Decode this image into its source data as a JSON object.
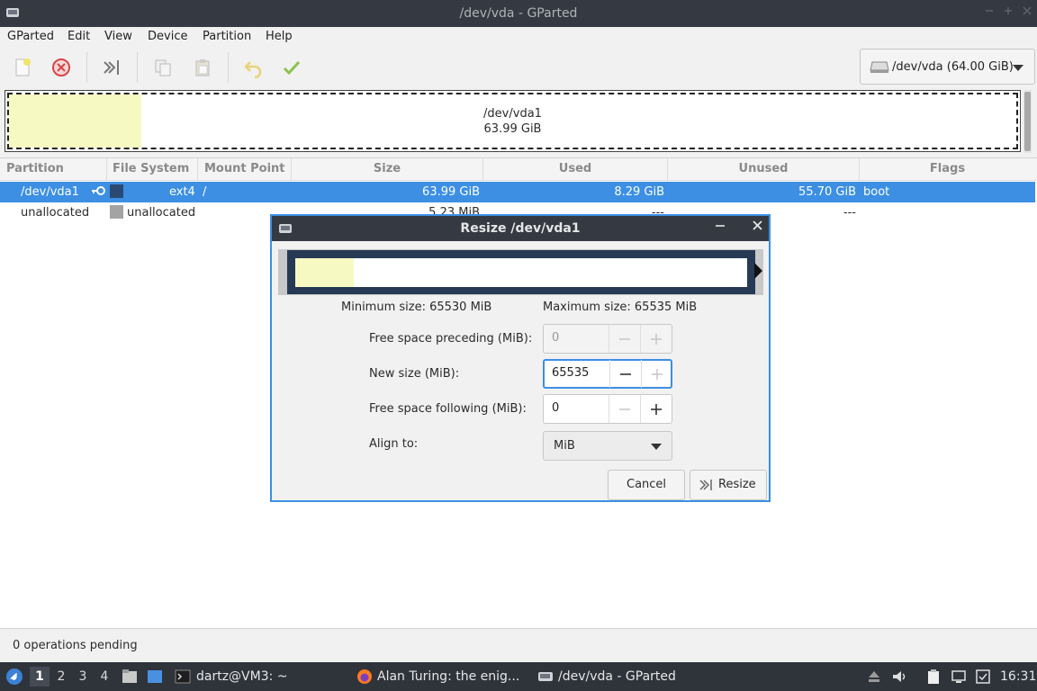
{
  "window": {
    "title": "/dev/vda - GParted"
  },
  "menubar": {
    "items": [
      "GParted",
      "Edit",
      "View",
      "Device",
      "Partition",
      "Help"
    ]
  },
  "toolbar": {
    "buttons": [
      "new-icon",
      "delete-icon",
      "resize-move-icon",
      "copy-icon",
      "paste-icon",
      "undo-icon",
      "apply-icon"
    ],
    "device_label": "/dev/vda (64.00 GiB)"
  },
  "disk_map": {
    "partition_name": "/dev/vda1",
    "partition_size": "63.99 GiB",
    "used_fraction": 0.13,
    "colors": {
      "used": "#f7f9c2",
      "frame": "#263a55"
    }
  },
  "table": {
    "columns": [
      "Partition",
      "File System",
      "Mount Point",
      "Size",
      "Used",
      "Unused",
      "Flags"
    ],
    "rows": [
      {
        "partition": "/dev/vda1",
        "filesystem": "ext4",
        "mount": "/",
        "size": "63.99 GiB",
        "used": "8.29 GiB",
        "unused": "55.70 GiB",
        "flags": "boot",
        "fs_color": "#2a4a73",
        "selected": true
      },
      {
        "partition": "unallocated",
        "filesystem": "unallocated",
        "mount": "",
        "size": "5.23 MiB",
        "used": "---",
        "unused": "---",
        "flags": "",
        "fs_color": "#a3a3a3",
        "selected": false
      }
    ]
  },
  "status": {
    "text": "0 operations pending"
  },
  "taskbar": {
    "workspaces": [
      "1",
      "2",
      "3",
      "4"
    ],
    "tasks": [
      "dartz@VM3: ~",
      "Alan Turing: the enig...",
      "/dev/vda - GParted"
    ],
    "clock": "16:31"
  },
  "dialog": {
    "title": "Resize /dev/vda1",
    "min_size": "Minimum size: 65530 MiB",
    "max_size": "Maximum size: 65535 MiB",
    "fields": {
      "preceding": {
        "label": "Free space preceding (MiB):",
        "value": "0"
      },
      "new_size": {
        "label": "New size (MiB):",
        "value": "65535"
      },
      "following": {
        "label": "Free space following (MiB):",
        "value": "0"
      },
      "align": {
        "label": "Align to:",
        "value": "MiB"
      }
    },
    "cancel_label": "Cancel",
    "resize_label": "Resize"
  }
}
